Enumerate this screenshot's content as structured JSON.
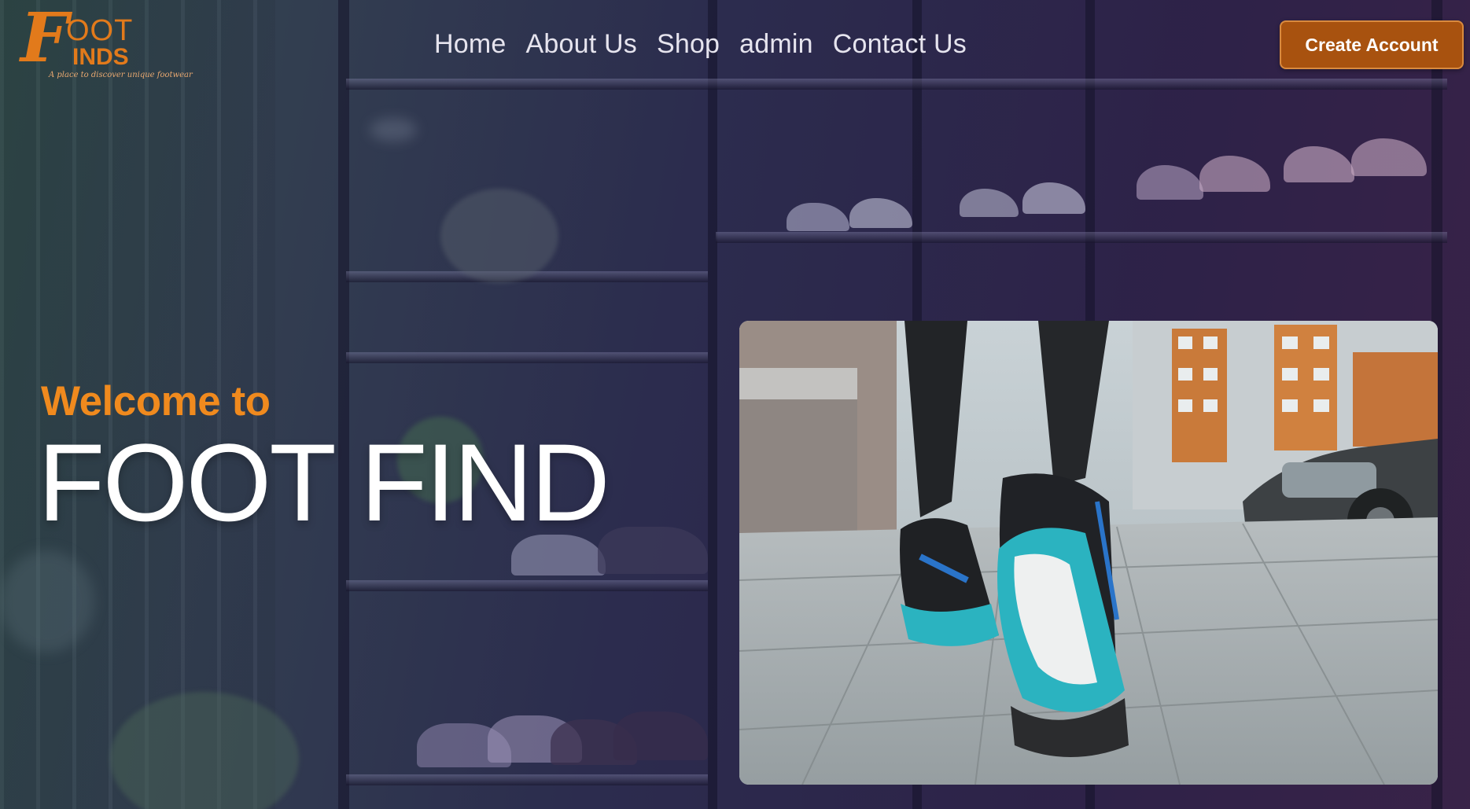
{
  "brand": {
    "logo_initial": "F",
    "logo_line1": "OOT",
    "logo_line2": "INDS",
    "logo_tagline": "A place to discover unique footwear"
  },
  "nav": {
    "items": [
      {
        "label": "Home"
      },
      {
        "label": "About Us"
      },
      {
        "label": "Shop"
      },
      {
        "label": "admin"
      },
      {
        "label": "Contact Us"
      }
    ]
  },
  "header": {
    "cta_label": "Create Account"
  },
  "hero": {
    "welcome": "Welcome to",
    "title": "FOOT FIND",
    "image_icon": "running-shoe-photo"
  },
  "colors": {
    "accent": "#f08a1e",
    "button": "#a8520f",
    "nav_text": "#e6e4ee",
    "title_text": "#ffffff",
    "shoe_teal": "#2bb3c0"
  }
}
